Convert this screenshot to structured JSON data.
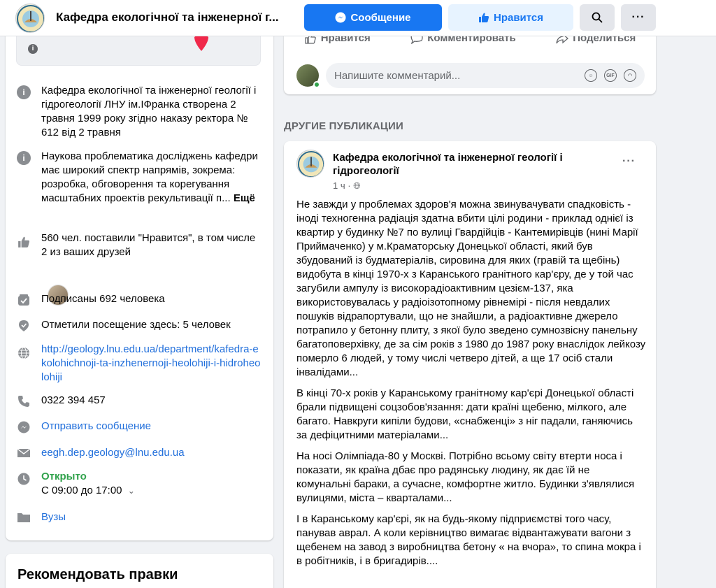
{
  "header": {
    "title": "Кафедра екологічної та інженерної г...",
    "message_button": "Сообщение",
    "like_button": "Нравится"
  },
  "intro": {
    "description": "Кафедра екологічної та інженерної геології і гідрогеології ЛНУ ім.ІФранка створена 2 травня 1999 року згідно наказу ректора № 612 від 2 травня",
    "science_text": "Наукова проблематика досліджень кафедри має широкий спектр напрямів, зокрема: розробка, обговорення та корегування масштабних проектів рекультивації п...",
    "science_more": "Ещё",
    "likes": "560 чел. поставили \"Нравится\", в том числе 2 из ваших друзей",
    "followers": "Подписаны 692 человека",
    "checkins": "Отметили посещение здесь: 5 человек",
    "website": "http://geology.lnu.edu.ua/department/kafedra-ekolohichnoji-ta-inzhenernoji-heolohiji-i-hidroheolohiji",
    "phone": "0322 394 457",
    "send_message": "Отправить сообщение",
    "email": "eegh.dep.geology@lnu.edu.ua",
    "open_status": "Открыто",
    "hours": "С 09:00 до 17:00",
    "category": "Вузы"
  },
  "recommend": {
    "title": "Рекомендовать правки"
  },
  "actions": {
    "like": "Нравится",
    "comment": "Комментировать",
    "share": "Поделиться"
  },
  "comment": {
    "placeholder": "Напишите комментарий..."
  },
  "other_posts": {
    "heading": "ДРУГИЕ ПУБЛИКАЦИИ"
  },
  "post": {
    "author": "Кафедра екологічної та інженерної геології і гідрогеології",
    "time": "1 ч",
    "paragraphs": [
      "Не завжди у проблемах здоров'я можна звинувачувати спадковість - іноді техногенна радіація здатна вбити цілі родини - приклад однієї із квартир у будинку №7 по вулиці Гвардійців - Кантемирівців (нині Марії Приймаченко) у м.Краматорську Донецької області, який був збудований із будматеріалів, сировина для яких (гравій та щебінь) видобута в кінці 1970-х з Каранського гранітного кар'єру, де у той час  загубили ампулу із високорадіоактивним цезієм-137, яка використовувалась у радіоізотопному  рівнемірі - після невдалих пошуків відрапортували, що не знайшли, а радіоактивне джерело потрапило у бетонну плиту, з якої було зведено сумнозвісну панельну багатоповерхівку, де за сім років з 1980 до 1987 року внаслідок лейкозу померло 6 людей, у тому числі четверо дітей, а ще 17 осіб стали інвалідами...",
      "В кінці 70-х років у Каранському гранітному кар'єрі Донецької області брали підвищені соцзобов'язання: дати країні щебеню, мілкого, але багато.  Навкруги кипіли будови, «снабженці» з ніг падали, ганяючись за дефіцитними матеріалами...",
      "На носі Олімпіада-80 у Москві. Потрібно всьому світу втерти носа і показати, як  країна дбає про радянську людину, як дає їй  не комунальні бараки, а сучасне, комфортне житло.  Будинки з'являлися вулицями, міста – кварталами...",
      "І в Каранському кар'єрі, як на будь-якому підприємстві того часу, панував аврал. А коли керівництво вимагає відвантажувати вагони з щебенем  на  завод з виробництва бетону « на вчора», то спина мокра і в робітників, і в бригадирів...."
    ]
  },
  "colors": {
    "brand": "#1877f2",
    "link": "#216fdb",
    "open": "#31a24c"
  }
}
